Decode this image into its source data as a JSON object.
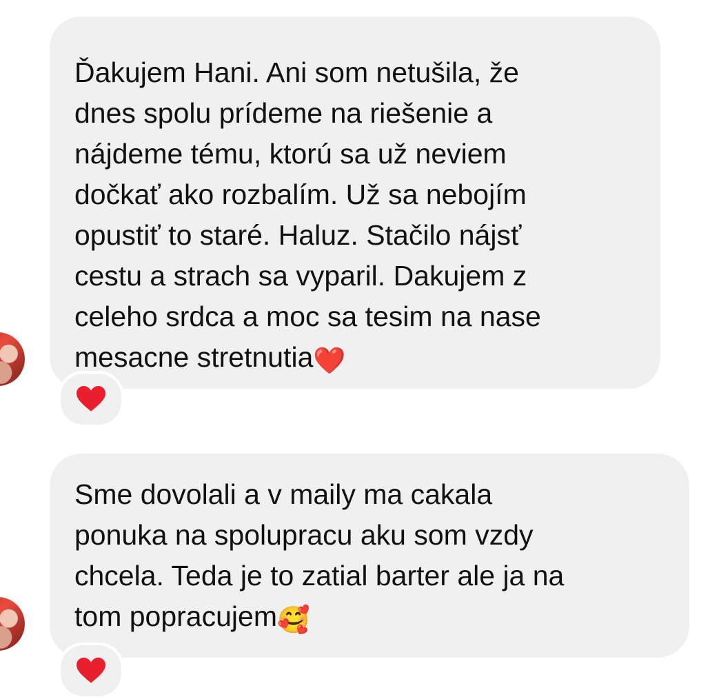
{
  "messages": [
    {
      "text": "Ďakujem Hani. Ani som netušila, že\ndnes spolu prídeme na riešenie a\nnájdeme tému, ktorú sa už neviem\ndočkať ako rozbalím. Už sa nebojím\nopustiť to staré. Haluz. Stačilo nájsť\ncestu a strach sa vyparil. Dakujem z\nceleho srdca a moc sa tesim na nase\nmesacne stretnutia",
      "trailing_emoji": "❤️",
      "reaction": "heart-reaction-icon"
    },
    {
      "text": "Sme dovolali a v maily ma cakala\nponuka na spolupracu aku som vzdy\nchcela. Teda je to zatial barter ale ja na\ntom popracujem",
      "trailing_emoji": "🥰",
      "reaction": "heart-reaction-icon"
    }
  ],
  "colors": {
    "bubble": "#f0f0f0",
    "text": "#111111",
    "heart": "#e8202d",
    "background": "#ffffff"
  }
}
